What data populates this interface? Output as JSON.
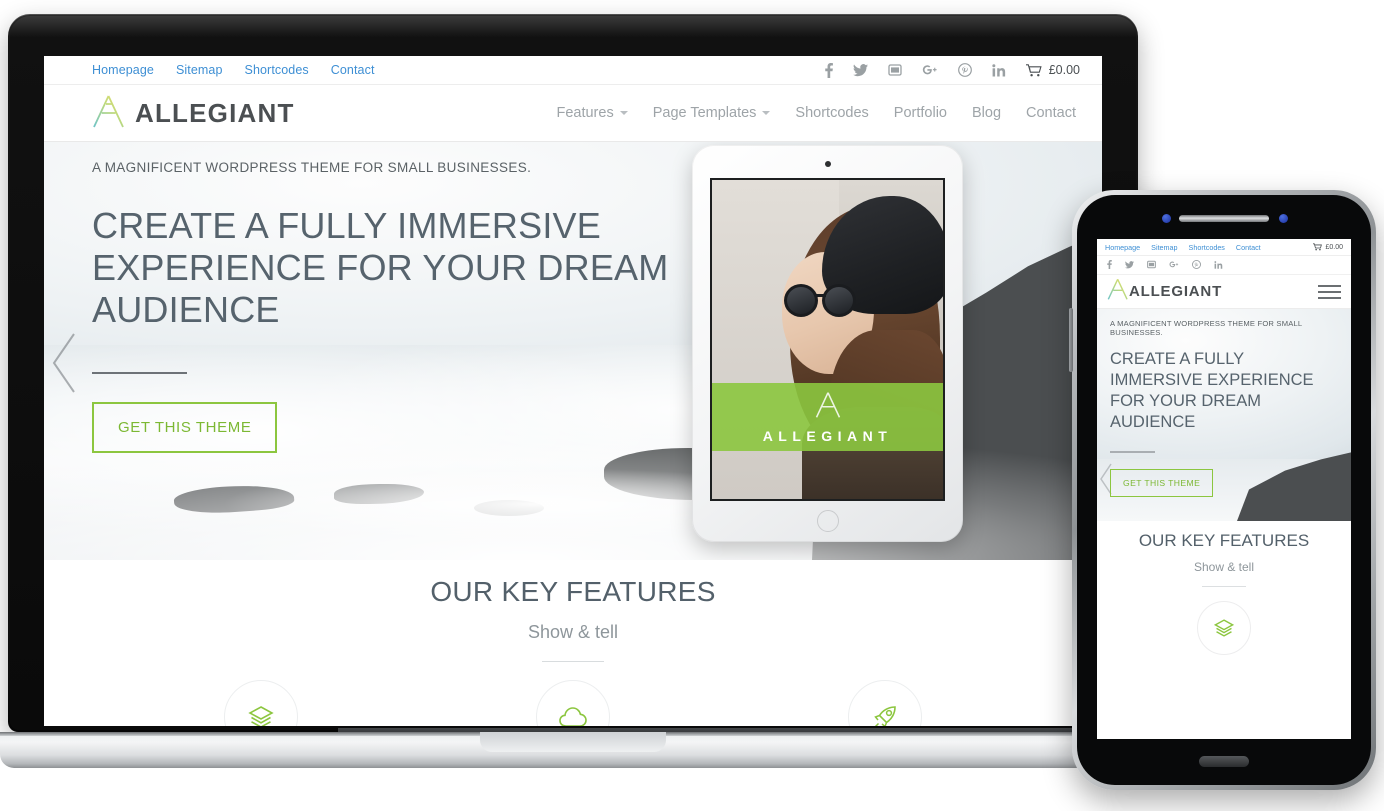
{
  "site": {
    "topbar": {
      "links": [
        {
          "label": "Homepage"
        },
        {
          "label": "Sitemap"
        },
        {
          "label": "Shortcodes"
        },
        {
          "label": "Contact"
        }
      ],
      "social": [
        {
          "name": "facebook-icon",
          "glyph": "f"
        },
        {
          "name": "twitter-icon",
          "glyph": "t"
        },
        {
          "name": "youtube-icon",
          "glyph": "y"
        },
        {
          "name": "googleplus-icon",
          "glyph": "g+"
        },
        {
          "name": "pinterest-icon",
          "glyph": "p"
        },
        {
          "name": "linkedin-icon",
          "glyph": "in"
        }
      ],
      "cart_total": "£0.00"
    },
    "brand": {
      "name": "ALLEGIANT",
      "logo_icon": "allegiant-a-logo"
    },
    "nav": [
      {
        "label": "Features",
        "has_dropdown": true
      },
      {
        "label": "Page Templates",
        "has_dropdown": true
      },
      {
        "label": "Shortcodes",
        "has_dropdown": false
      },
      {
        "label": "Portfolio",
        "has_dropdown": false
      },
      {
        "label": "Blog",
        "has_dropdown": false
      },
      {
        "label": "Contact",
        "has_dropdown": false
      }
    ],
    "hero": {
      "kicker": "A MAGNIFICENT WORDPRESS THEME FOR SMALL BUSINESSES.",
      "headline": "CREATE A FULLY IMMERSIVE EXPERIENCE FOR YOUR DREAM AUDIENCE",
      "cta_label": "GET THIS THEME",
      "prev_arrow_icon": "chevron-left-icon"
    },
    "tablet": {
      "band_word": "ALLEGIANT",
      "band_logo_icon": "allegiant-a-logo"
    },
    "features": {
      "title": "OUR KEY FEATURES",
      "subtitle": "Show & tell",
      "items": [
        {
          "icon": "layers-icon"
        },
        {
          "icon": "cloud-icon"
        },
        {
          "icon": "rocket-icon"
        }
      ]
    }
  },
  "colors": {
    "accent_green": "#8cc63f",
    "link_blue": "#3e8fd4",
    "heading_slate": "#56636d",
    "muted_grey": "#9ea4a8"
  }
}
